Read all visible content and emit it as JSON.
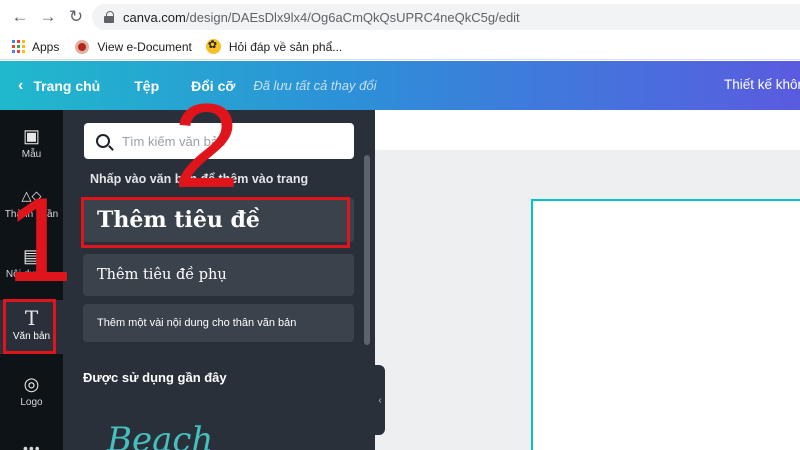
{
  "browser": {
    "url_host": "canva.com",
    "url_path": "/design/DAEsDlx9lx4/Og6aCmQkQsUPRC4neQkC5g/edit",
    "bookmarks": [
      {
        "label": "Apps",
        "icon": "apps-grid-icon"
      },
      {
        "label": "View e-Document",
        "icon": "red-circle-icon"
      },
      {
        "label": "Hỏi đáp về sản phẩ...",
        "icon": "yellow-flower-icon"
      }
    ]
  },
  "topbar": {
    "back_icon": "‹",
    "home": "Trang chủ",
    "file": "Tệp",
    "resize": "Đổi cỡ",
    "saved_status": "Đã lưu tất cả thay đổi",
    "design_title": "Thiết kế khôn"
  },
  "rail": {
    "items": [
      {
        "label": "Mẫu",
        "icon": "▣"
      },
      {
        "label": "Thành phần",
        "icon": "△◇"
      },
      {
        "label": "Nội dung ...",
        "icon": "▤"
      },
      {
        "label": "Văn bản",
        "icon": "T"
      },
      {
        "label": "Logo",
        "icon": "◎"
      }
    ],
    "more": "•••"
  },
  "panel": {
    "search_placeholder": "Tìm kiếm văn bản",
    "hint": "Nhấp vào văn bản để thêm vào trang",
    "add_heading": "Thêm tiêu đề",
    "add_subheading": "Thêm tiêu đề phụ",
    "add_body": "Thêm một vài nội dung cho thân văn bản",
    "recent_title": "Được sử dụng gần đây",
    "recent_sample": "Beach"
  },
  "annotations": {
    "step1": "1",
    "step2": "2",
    "highlight_color": "#e0151b"
  },
  "colors": {
    "topbar_start": "#20b9cc",
    "topbar_end": "#5a5be0",
    "rail_bg": "#0e1318",
    "panel_bg": "#293039",
    "canvas_border": "#00c4cc"
  }
}
